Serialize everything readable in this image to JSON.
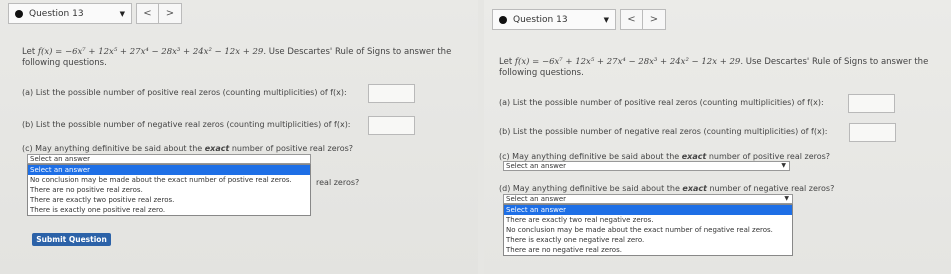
{
  "left": {
    "question_label": "Question 13",
    "prev": "<",
    "next": ">",
    "statement_prefix": "Let",
    "function_expr": "f(x) = −6x⁷ + 12x⁵ + 27x⁴ − 28x³ + 24x² − 12x + 29.",
    "statement_suffix": "Use Descartes' Rule of Signs to answer the following questions.",
    "part_a": "(a) List the possible number of positive real zeros (counting multiplicities) of f(x):",
    "part_b": "(b) List the possible number of negative real zeros (counting multiplicities) of f(x):",
    "part_c_pre": "(c) May anything definitive be said about the",
    "exact": "exact",
    "part_c_post": "number of positive real zeros?",
    "select_c_value": "Select an answer",
    "dropdown_options": [
      "Select an answer",
      "No conclusion may be made about the exact number of postive real zeros.",
      "There are no positive real zeros.",
      "There are exactly two positive real zeros.",
      "There is exactly one positive real zero."
    ],
    "part_d_tail": "real zeros?",
    "submit_label": "Submit Question"
  },
  "right": {
    "question_label": "Question 13",
    "prev": "<",
    "next": ">",
    "statement_prefix": "Let",
    "function_expr": "f(x) = −6x⁷ + 12x⁵ + 27x⁴ − 28x³ + 24x² − 12x + 29.",
    "statement_suffix": "Use Descartes' Rule of Signs to answer the following questions.",
    "part_a": "(a) List the possible number of positive real zeros (counting multiplicities) of f(x):",
    "part_b": "(b) List the possible number of negative real zeros (counting multiplicities) of f(x):",
    "part_c_pre": "(c) May anything definitive be said about the",
    "exact": "exact",
    "part_c_post": "number of positive real zeros?",
    "select_c_value": "Select an answer",
    "part_d_pre": "(d) May anything definitive be said about the",
    "part_d_post": "number of negative real zeros?",
    "select_d_value": "Select an answer",
    "dropdown_options": [
      "Select an answer",
      "There are exactly two real negative zeros.",
      "No conclusion may be made about the exact number of negative real zeros.",
      "There is exactly one negative real zero.",
      "There are no negative real zeros."
    ]
  },
  "colors": {
    "accent": "#2c62a8",
    "highlight": "#1e6fe6"
  },
  "icons": {
    "bullet": "filled-circle",
    "caret": "triangle-down"
  }
}
